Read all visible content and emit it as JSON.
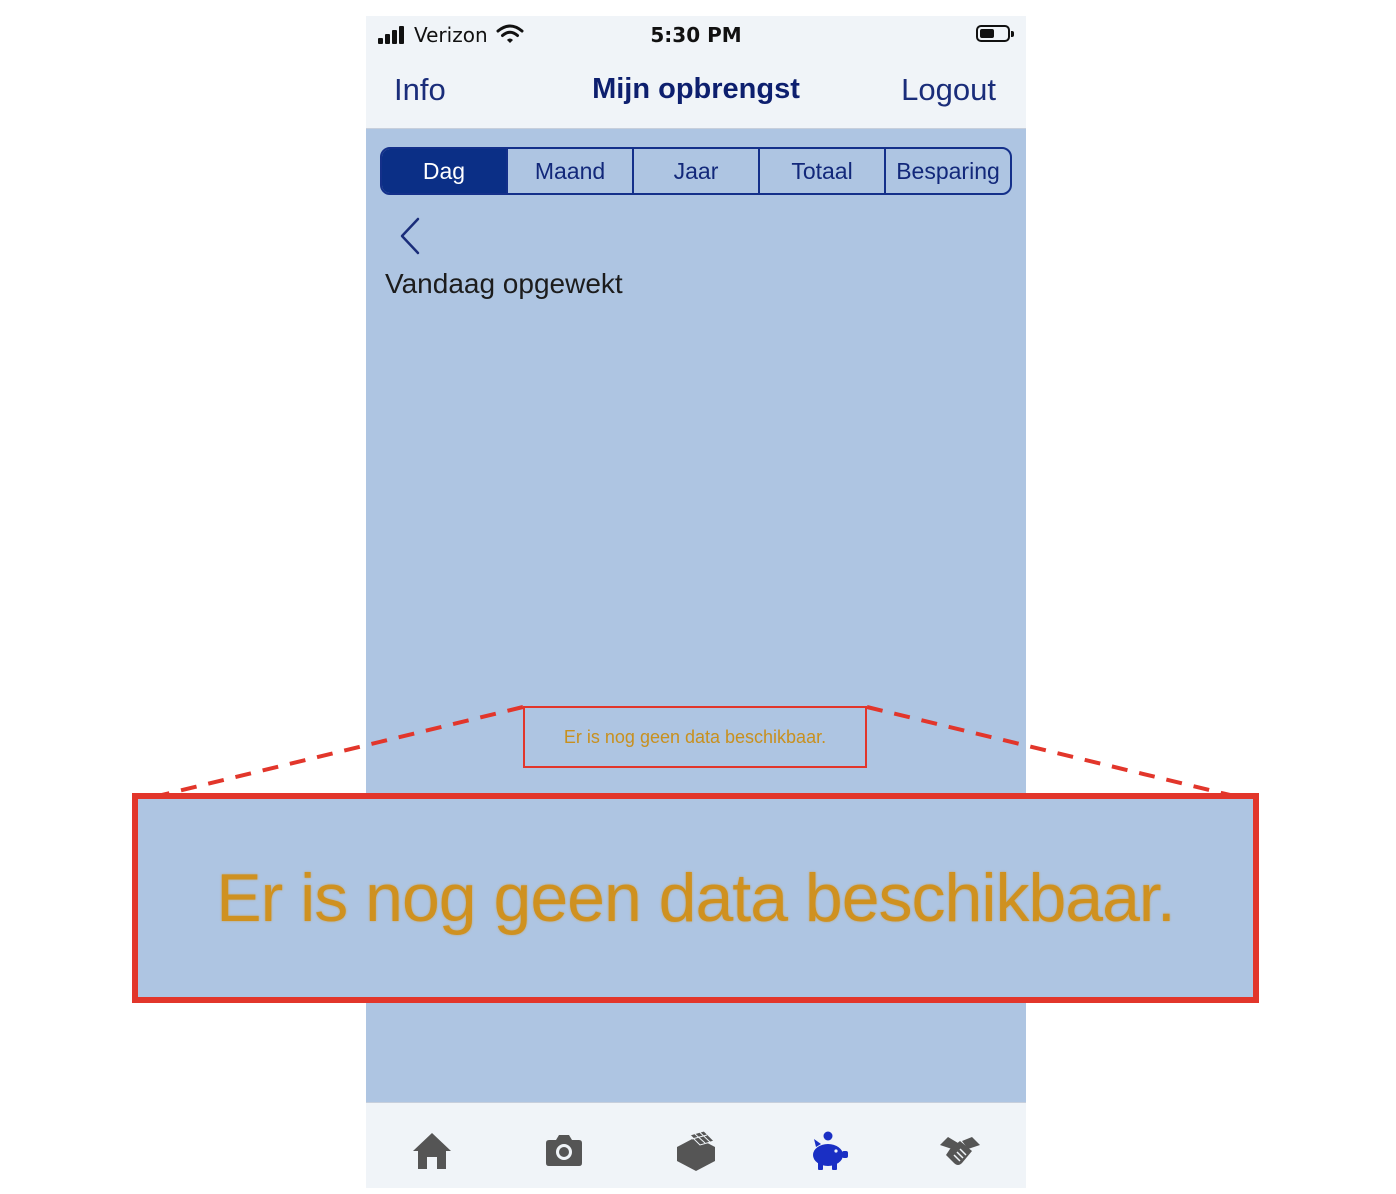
{
  "status_bar": {
    "carrier": "Verizon",
    "time": "5:30 PM"
  },
  "nav": {
    "left_label": "Info",
    "title": "Mijn opbrengst",
    "right_label": "Logout"
  },
  "segments": [
    {
      "label": "Dag",
      "active": true
    },
    {
      "label": "Maand",
      "active": false
    },
    {
      "label": "Jaar",
      "active": false
    },
    {
      "label": "Totaal",
      "active": false
    },
    {
      "label": "Besparing",
      "active": false
    }
  ],
  "content": {
    "subtitle": "Vandaag opgewekt",
    "empty_message": "Er is nog geen data beschikbaar."
  },
  "zoom": {
    "text": "Er is nog geen data beschikbaar."
  },
  "tab_bar": {
    "icons": [
      "home-icon",
      "camera-icon",
      "solar-panel-icon",
      "piggy-bank-icon",
      "handshake-icon"
    ],
    "active_index": 3,
    "active_color": "#1a2fc4",
    "inactive_color": "#555555"
  },
  "colors": {
    "accent": "#0b2f86",
    "highlight_border": "#e2362b",
    "message_text": "#c8901e",
    "content_bg": "#aec5e2"
  }
}
